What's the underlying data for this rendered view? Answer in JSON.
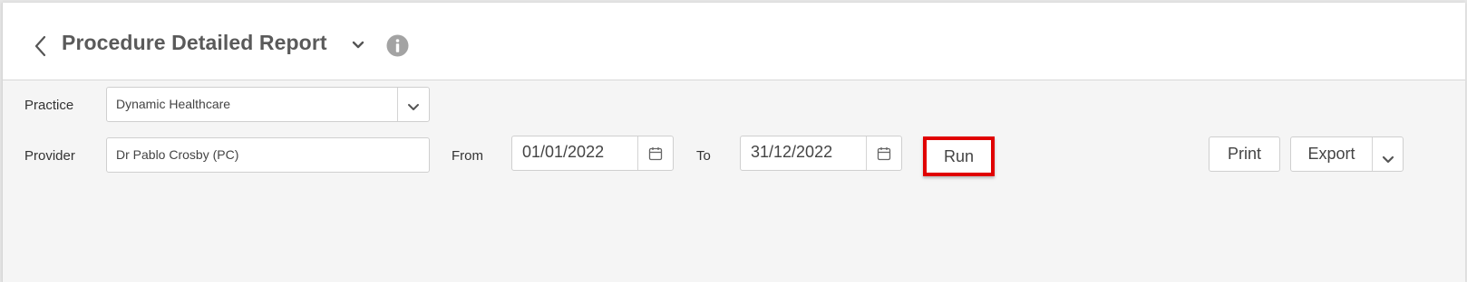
{
  "header": {
    "title": "Procedure Detailed Report"
  },
  "filters": {
    "practice_label": "Practice",
    "practice_value": "Dynamic Healthcare",
    "provider_label": "Provider",
    "provider_value": "Dr Pablo Crosby (PC)",
    "from_label": "From",
    "from_value": "01/01/2022",
    "to_label": "To",
    "to_value": "31/12/2022"
  },
  "actions": {
    "run_label": "Run",
    "print_label": "Print",
    "export_label": "Export"
  },
  "colors": {
    "highlight": "#e00000",
    "icon_gray": "#9a9a9a"
  },
  "icons": {
    "back": "chevron-left-icon",
    "title_dropdown": "chevron-down-icon",
    "info": "info-circle-icon",
    "calendar": "calendar-icon"
  }
}
